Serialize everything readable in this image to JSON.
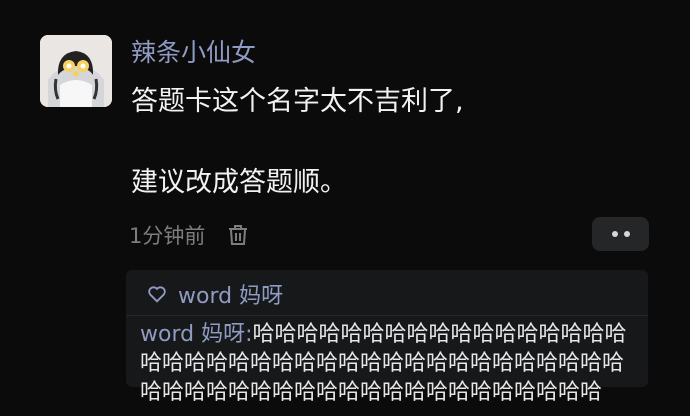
{
  "post": {
    "username": "辣条小仙女",
    "content_line1": "答题卡这个名字太不吉利了,",
    "content_line2": "建议改成答题顺。",
    "timestamp": "1分钟前",
    "delete_icon": "trash-icon",
    "more_icon": "more-dots-icon"
  },
  "likes": {
    "heart_icon": "heart-outline-icon",
    "liker": "word 妈呀"
  },
  "reply": {
    "author": "word 妈呀",
    "separator": ":",
    "text": "哈哈哈哈哈哈哈哈哈哈哈哈哈哈哈哈哈哈哈哈哈哈哈哈哈哈哈哈哈哈哈哈哈哈哈哈哈哈哈哈哈哈哈哈哈哈哈哈哈哈哈哈哈哈哈哈哈哈哈哈"
  },
  "colors": {
    "accent": "#8f9bc2",
    "background": "#0b0b0b",
    "panel": "#17181a"
  }
}
